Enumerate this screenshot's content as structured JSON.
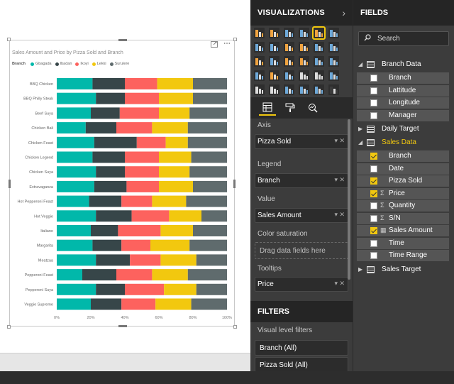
{
  "visual": {
    "title": "Sales Amount and Price by Pizza Sold and Branch",
    "legend_title": "Branch",
    "focus_icon": "focus-mode-icon",
    "more_icon": "more-options-icon"
  },
  "chart_data": {
    "type": "bar",
    "orientation": "horizontal",
    "stacked": "100%",
    "title": "Sales Amount and Price by Pizza Sold and Branch",
    "legend_title": "Branch",
    "categories": [
      "BBQ Chicken",
      "BBQ Philly Steak",
      "Beef Suya",
      "Chicken Bali",
      "Chicken Feast",
      "Chicken Legend",
      "Chicken Suya",
      "Extravaganza",
      "Hot Pepperoni Feast",
      "Hot Veggie",
      "Italiano",
      "Margarita",
      "Meatzaa",
      "Pepperoni Feast",
      "Pepperoni Suya",
      "Veggie Supreme"
    ],
    "series": [
      {
        "name": "Gbagada",
        "color": "#01b8aa",
        "values": [
          21,
          23,
          20,
          17,
          22,
          21,
          23,
          22,
          19,
          23,
          20,
          21,
          23,
          15,
          23,
          20
        ]
      },
      {
        "name": "Ibadan",
        "color": "#374649",
        "values": [
          19,
          17,
          17,
          18,
          25,
          19,
          17,
          19,
          19,
          21,
          16,
          17,
          20,
          20,
          17,
          18
        ]
      },
      {
        "name": "Ikoyi",
        "color": "#fd625e",
        "values": [
          19,
          20,
          23,
          21,
          17,
          20,
          20,
          19,
          18,
          22,
          25,
          17,
          18,
          21,
          23,
          20
        ]
      },
      {
        "name": "Lekki",
        "color": "#f2c80f",
        "values": [
          21,
          20,
          18,
          21,
          13,
          19,
          18,
          20,
          20,
          19,
          19,
          23,
          21,
          21,
          19,
          21
        ]
      },
      {
        "name": "Surulere",
        "color": "#5f6b6d",
        "values": [
          20,
          20,
          22,
          23,
          23,
          21,
          22,
          20,
          24,
          15,
          20,
          22,
          18,
          23,
          18,
          21
        ]
      }
    ],
    "x_ticks": [
      "0%",
      "20%",
      "40%",
      "60%",
      "80%",
      "100%"
    ],
    "xlim": [
      0,
      100
    ],
    "grid": false,
    "legend_position": "top-left"
  },
  "visualizations": {
    "title": "VISUALIZATIONS",
    "icons": [
      {
        "name": "stacked-bar-chart-icon",
        "color": "#f0a340"
      },
      {
        "name": "stacked-column-chart-icon",
        "color": "#f0a340"
      },
      {
        "name": "clustered-bar-chart-icon",
        "color": "#6ea9d9"
      },
      {
        "name": "clustered-column-chart-icon",
        "color": "#6ea9d9"
      },
      {
        "name": "100-stacked-bar-chart-icon",
        "color": "#f0a340",
        "selected": true
      },
      {
        "name": "100-stacked-column-chart-icon",
        "color": "#6ea9d9"
      },
      {
        "name": "line-chart-icon",
        "color": "#6ea9d9"
      },
      {
        "name": "area-chart-icon",
        "color": "#6ea9d9"
      },
      {
        "name": "stacked-area-chart-icon",
        "color": "#f0a340"
      },
      {
        "name": "line-and-stacked-column-icon",
        "color": "#f0a340"
      },
      {
        "name": "line-and-clustered-column-icon",
        "color": "#6ea9d9"
      },
      {
        "name": "ribbon-chart-icon",
        "color": "#6ea9d9"
      },
      {
        "name": "waterfall-chart-icon",
        "color": "#f0a340"
      },
      {
        "name": "scatter-chart-icon",
        "color": "#6ea9d9"
      },
      {
        "name": "pie-chart-icon",
        "color": "#f0a340"
      },
      {
        "name": "donut-chart-icon",
        "color": "#f0a340"
      },
      {
        "name": "treemap-icon",
        "color": "#6ea9d9"
      },
      {
        "name": "map-icon",
        "color": "#6ea9d9"
      },
      {
        "name": "filled-map-icon",
        "color": "#6ea9d9"
      },
      {
        "name": "funnel-icon",
        "color": "#f0a340"
      },
      {
        "name": "gauge-icon",
        "color": "#6ea9d9"
      },
      {
        "name": "card-icon",
        "color": "#dcdcdc"
      },
      {
        "name": "multi-row-card-icon",
        "color": "#dcdcdc"
      },
      {
        "name": "kpi-icon",
        "color": "#6ea9d9"
      },
      {
        "name": "slicer-icon",
        "color": "#dcdcdc"
      },
      {
        "name": "table-icon",
        "color": "#dcdcdc"
      },
      {
        "name": "matrix-icon",
        "color": "#6ea9d9"
      },
      {
        "name": "r-script-visual-icon",
        "color": "#6ea9d9"
      },
      {
        "name": "globe-icon",
        "color": "#6ea9d9"
      },
      {
        "name": "more-visuals-icon",
        "color": "#3c3c3c"
      }
    ],
    "tabs": [
      "fields-tab-icon",
      "format-paint-roller-icon",
      "analytics-magnifier-icon"
    ],
    "wells": {
      "axis_label": "Axis",
      "axis_value": "Pizza Sold",
      "legend_label": "Legend",
      "legend_value": "Branch",
      "value_label": "Value",
      "value_value": "Sales Amount",
      "color_saturation_label": "Color saturation",
      "drag_placeholder": "Drag data fields here",
      "tooltips_label": "Tooltips",
      "tooltips_value": "Price"
    }
  },
  "filters": {
    "title": "FILTERS",
    "visual_level_label": "Visual level filters",
    "items": [
      "Branch  (All)",
      "Pizza Sold  (All)"
    ]
  },
  "fields": {
    "title": "FIELDS",
    "search_placeholder": "Search",
    "tables": [
      {
        "name": "Branch Data",
        "expanded": true,
        "active": false
      },
      {
        "name": "Daily Target",
        "expanded": false,
        "active": false
      },
      {
        "name": "Sales Data",
        "expanded": true,
        "active": true
      },
      {
        "name": "Sales Target",
        "expanded": false,
        "active": false
      }
    ],
    "branch_data_fields": [
      {
        "name": "Branch",
        "checked": false,
        "type": ""
      },
      {
        "name": "Lattitude",
        "checked": false,
        "type": ""
      },
      {
        "name": "Longitude",
        "checked": false,
        "type": ""
      },
      {
        "name": "Manager",
        "checked": false,
        "type": ""
      }
    ],
    "sales_data_fields": [
      {
        "name": "Branch",
        "checked": true,
        "type": ""
      },
      {
        "name": "Date",
        "checked": false,
        "type": ""
      },
      {
        "name": "Pizza Sold",
        "checked": true,
        "type": ""
      },
      {
        "name": "Price",
        "checked": true,
        "type": "Σ"
      },
      {
        "name": "Quantity",
        "checked": false,
        "type": "Σ"
      },
      {
        "name": "S/N",
        "checked": false,
        "type": "Σ"
      },
      {
        "name": "Sales Amount",
        "checked": true,
        "type": "▦"
      },
      {
        "name": "Time",
        "checked": false,
        "type": ""
      },
      {
        "name": "Time Range",
        "checked": false,
        "type": ""
      }
    ]
  }
}
